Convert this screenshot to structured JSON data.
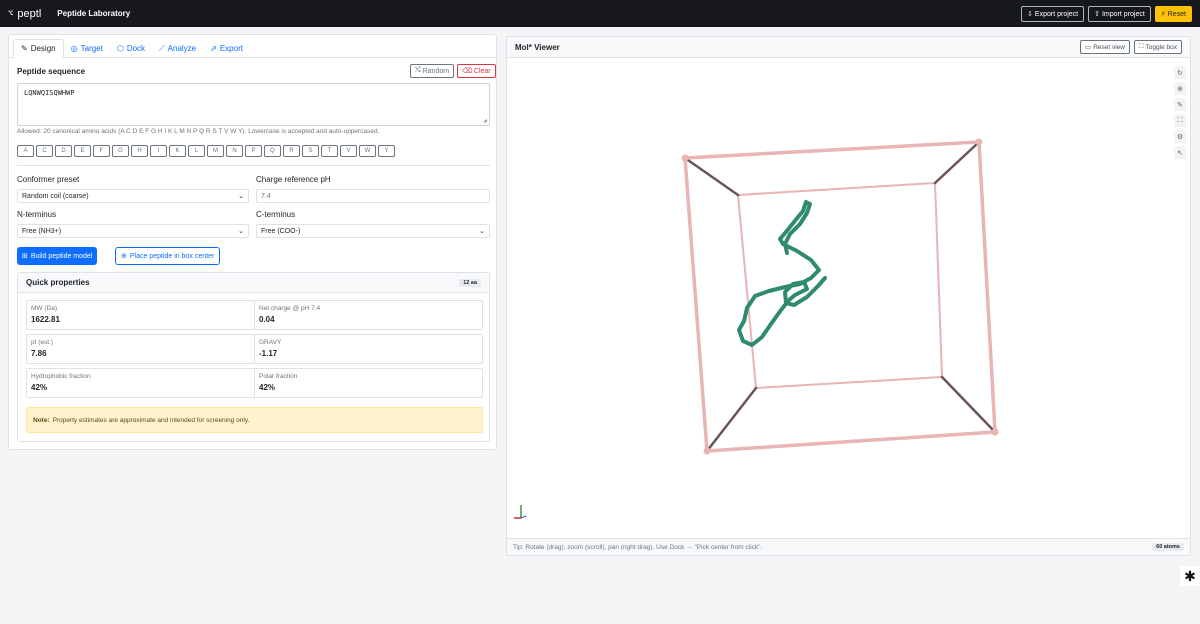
{
  "app": {
    "brand_icon": "⌥",
    "name": "peptl",
    "title": "Peptide Laboratory"
  },
  "top_actions": {
    "export": "Export project",
    "import": "Import project",
    "reset": "Reset"
  },
  "tabs": [
    {
      "label": "Design",
      "icon": "pencil-icon"
    },
    {
      "label": "Target",
      "icon": "target-icon"
    },
    {
      "label": "Dock",
      "icon": "cube-icon"
    },
    {
      "label": "Analyze",
      "icon": "chart-icon"
    },
    {
      "label": "Export",
      "icon": "export-icon"
    }
  ],
  "sequence": {
    "title": "Peptide sequence",
    "random_label": "Random",
    "clear_label": "Clear",
    "value": "LQNWQISQWHWP",
    "allowed_text": "Allowed: 20 canonical amino acids (A C D E F G H I K L M N P Q R S T V W Y). Lowercase is accepted and auto-uppercased."
  },
  "amino_acids": [
    "A",
    "C",
    "D",
    "E",
    "F",
    "G",
    "H",
    "I",
    "K",
    "L",
    "M",
    "N",
    "P",
    "Q",
    "R",
    "S",
    "T",
    "V",
    "W",
    "Y"
  ],
  "form": {
    "conformer_label": "Conformer preset",
    "conformer_value": "Random coil (coarse)",
    "ph_label": "Charge reference pH",
    "ph_value": "7.4",
    "nterm_label": "N-terminus",
    "nterm_value": "Free (NH3+)",
    "cterm_label": "C-terminus",
    "cterm_value": "Free (COO-)"
  },
  "actions": {
    "build": "Build peptide model",
    "place": "Place peptide in box center"
  },
  "quick_properties": {
    "title": "Quick properties",
    "badge": "12 aa",
    "metrics": [
      {
        "label": "MW (Da)",
        "value": "1622.81"
      },
      {
        "label": "Net charge @ pH 7.4",
        "value": "0.04"
      },
      {
        "label": "pI (est.)",
        "value": "7.86"
      },
      {
        "label": "GRAVY",
        "value": "-1.17"
      },
      {
        "label": "Hydrophobic fraction",
        "value": "42%"
      },
      {
        "label": "Polar fraction",
        "value": "42%"
      }
    ],
    "note_bold": "Note:",
    "note_text": "Property estimates are approximate and intended for screening only."
  },
  "viewer": {
    "title": "Mol* Viewer",
    "reset_view": "Reset view",
    "toggle_box": "Toggle box",
    "tip": "Tip: Rotate (drag), zoom (scroll), pan (right drag). Use Dock → \"Pick center from click\".",
    "atoms_badge": "60 atoms",
    "box_color": "#e8b4b4",
    "peptide_color": "#2e8b6b"
  }
}
